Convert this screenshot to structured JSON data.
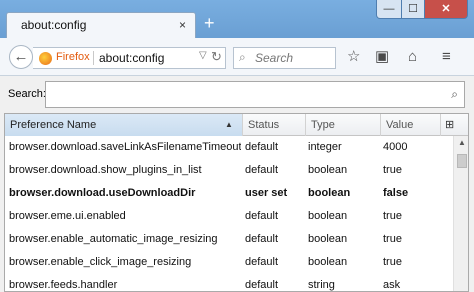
{
  "window": {
    "min_glyph": "—",
    "max_glyph": "☐",
    "close_glyph": "✕"
  },
  "tab": {
    "title": "about:config",
    "close_glyph": "×",
    "new_tab_glyph": "+"
  },
  "navbar": {
    "back_glyph": "←",
    "identity_label": "Firefox",
    "url": "about:config",
    "dropdown_glyph": "▽",
    "reload_glyph": "↻",
    "search_placeholder": "Search",
    "search_glyph": "⌕",
    "bookmark_glyph": "☆",
    "reader_glyph": "▣",
    "home_glyph": "⌂",
    "menu_glyph": "≡"
  },
  "config": {
    "search_label": "Search:",
    "search_value": "",
    "search_glyph": "⌕",
    "columns": {
      "name": "Preference Name",
      "status": "Status",
      "type": "Type",
      "value": "Value"
    },
    "sort_glyph": "▲",
    "column_picker_glyph": "⊞",
    "scroll_up_glyph": "▲",
    "rows": [
      {
        "name": "browser.download.saveLinkAsFilenameTimeout",
        "status": "default",
        "type": "integer",
        "value": "4000",
        "modified": false
      },
      {
        "name": "browser.download.show_plugins_in_list",
        "status": "default",
        "type": "boolean",
        "value": "true",
        "modified": false
      },
      {
        "name": "browser.download.useDownloadDir",
        "status": "user set",
        "type": "boolean",
        "value": "false",
        "modified": true
      },
      {
        "name": "browser.eme.ui.enabled",
        "status": "default",
        "type": "boolean",
        "value": "true",
        "modified": false
      },
      {
        "name": "browser.enable_automatic_image_resizing",
        "status": "default",
        "type": "boolean",
        "value": "true",
        "modified": false
      },
      {
        "name": "browser.enable_click_image_resizing",
        "status": "default",
        "type": "boolean",
        "value": "true",
        "modified": false
      },
      {
        "name": "browser.feeds.handler",
        "status": "default",
        "type": "string",
        "value": "ask",
        "modified": false
      }
    ]
  }
}
